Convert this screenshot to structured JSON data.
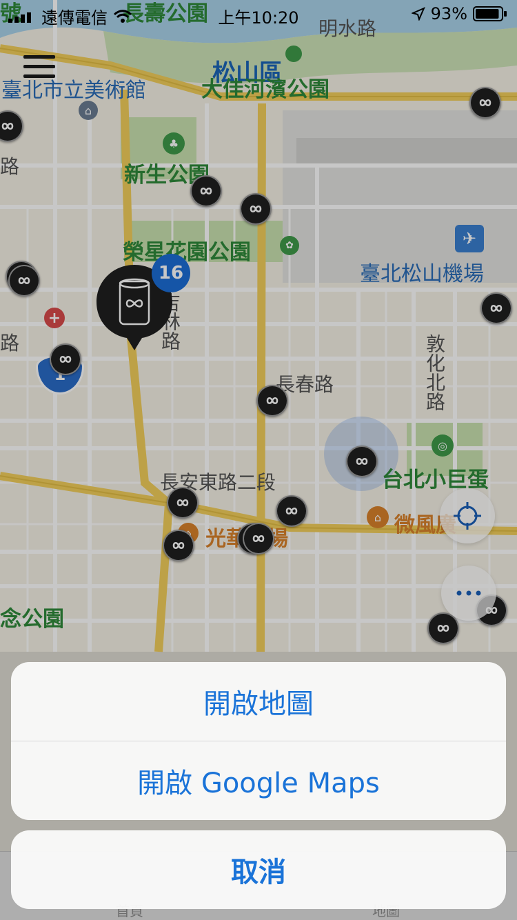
{
  "status_bar": {
    "carrier": "遠傳電信",
    "time": "上午10:20",
    "battery": "93%",
    "battery_level": 0.93
  },
  "map": {
    "labels": {
      "district": "松山區",
      "road_top": "長壽公園",
      "road_minshui": "明水路",
      "museum": "臺北市立美術館",
      "park_dajia": "大佳河濱公園",
      "park_xinsheng": "新生公園",
      "park_rongxing": "榮星花園公園",
      "airport": "臺北松山機場",
      "road_jilin": "吉林路",
      "road_changchun": "長春路",
      "road_dunhua": "敦化北路",
      "road_changan": "長安東路二段",
      "arena": "台北小巨蛋",
      "mall_guanghua": "光華商場",
      "weifeng": "微風廣",
      "park_memorial": "念公園",
      "left_clip_1": "號",
      "left_clip_2": "路",
      "left_clip_3": "路",
      "highway_num": "1"
    },
    "cluster_count": "16"
  },
  "action_sheet": {
    "open_maps": "開啟地圖",
    "open_google_maps": "開啟 Google Maps",
    "cancel": "取消"
  },
  "tab_bar": {
    "home": "首頁",
    "map": "地圖"
  },
  "colors": {
    "accent": "#1a73d8",
    "pin": "#1f1f1f",
    "badge": "#1b6ed6"
  }
}
